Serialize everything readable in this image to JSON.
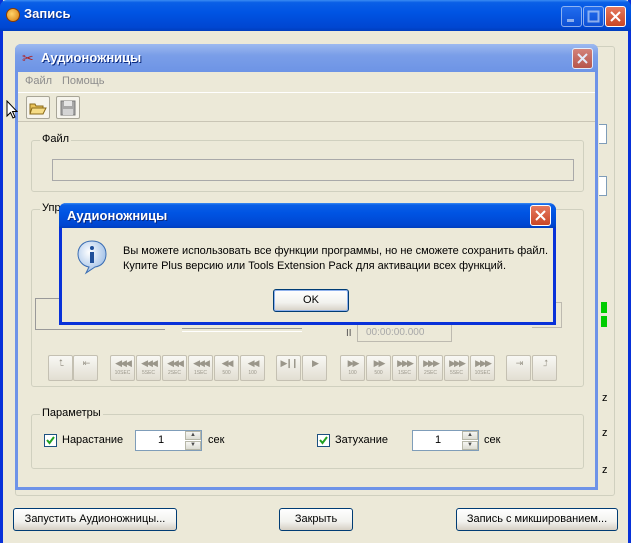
{
  "outer_window": {
    "title": "Запись",
    "buttons": {
      "launch": "Запустить Аудионожницы...",
      "close": "Закрыть",
      "record_mix": "Запись с микшированием..."
    },
    "right_edge_letters": [
      "z",
      "z",
      "z"
    ]
  },
  "app_window": {
    "title": "Аудионожницы",
    "menu": [
      "Файл",
      "Помощь"
    ],
    "toolbar": {
      "open_icon": "folder-open-icon",
      "save_icon": "save-icon"
    },
    "file_group": {
      "label": "Файл",
      "path_value": ""
    },
    "control_group": {
      "label_partial": "Упр"
    },
    "time_display": "00:00:00.000",
    "player_buttons": [
      {
        "name": "mark-start-button",
        "arrow": "⮤",
        "cap": ""
      },
      {
        "name": "goto-start-button",
        "arrow": "⇤",
        "cap": ""
      },
      {
        "name": "back-10sec-button",
        "arrow": "◀◀◀",
        "cap": "10SEC"
      },
      {
        "name": "back-5sec-button",
        "arrow": "◀◀◀",
        "cap": "5SEC"
      },
      {
        "name": "back-2sec-button",
        "arrow": "◀◀◀",
        "cap": "2SEC"
      },
      {
        "name": "back-1sec-button",
        "arrow": "◀◀◀",
        "cap": "1SEC"
      },
      {
        "name": "back-500-button",
        "arrow": "◀◀",
        "cap": "500"
      },
      {
        "name": "back-100-button",
        "arrow": "◀◀",
        "cap": "100"
      },
      {
        "name": "play-pause-button",
        "arrow": "▶❙❙",
        "cap": ""
      },
      {
        "name": "play-button",
        "arrow": "▶",
        "cap": ""
      },
      {
        "name": "fwd-100-button",
        "arrow": "▶▶",
        "cap": "100"
      },
      {
        "name": "fwd-500-button",
        "arrow": "▶▶",
        "cap": "500"
      },
      {
        "name": "fwd-1sec-button",
        "arrow": "▶▶▶",
        "cap": "1SEC"
      },
      {
        "name": "fwd-2sec-button",
        "arrow": "▶▶▶",
        "cap": "2SEC"
      },
      {
        "name": "fwd-5sec-button",
        "arrow": "▶▶▶",
        "cap": "5SEC"
      },
      {
        "name": "fwd-10sec-button",
        "arrow": "▶▶▶",
        "cap": "10SEC"
      },
      {
        "name": "goto-end-button",
        "arrow": "⇥",
        "cap": ""
      },
      {
        "name": "mark-end-button",
        "arrow": "⮥",
        "cap": ""
      }
    ],
    "params": {
      "label": "Параметры",
      "fade_in": {
        "label": "Нарастание",
        "checked": true,
        "value": "1",
        "unit": "сек"
      },
      "fade_out": {
        "label": "Затухание",
        "checked": true,
        "value": "1",
        "unit": "сек"
      }
    }
  },
  "dialog": {
    "title": "Аудионожницы",
    "message_line1": "Вы можете использовать все функции программы, но не сможете сохранить файл.",
    "message_line2": "Купите Plus версию или Tools Extension Pack для активации всех функций.",
    "ok": "OK",
    "icon": "info-icon"
  },
  "colors": {
    "xp_blue": "#0054e3",
    "dialog_bg": "#ece9d8",
    "green_indicator": "#00cc00"
  }
}
